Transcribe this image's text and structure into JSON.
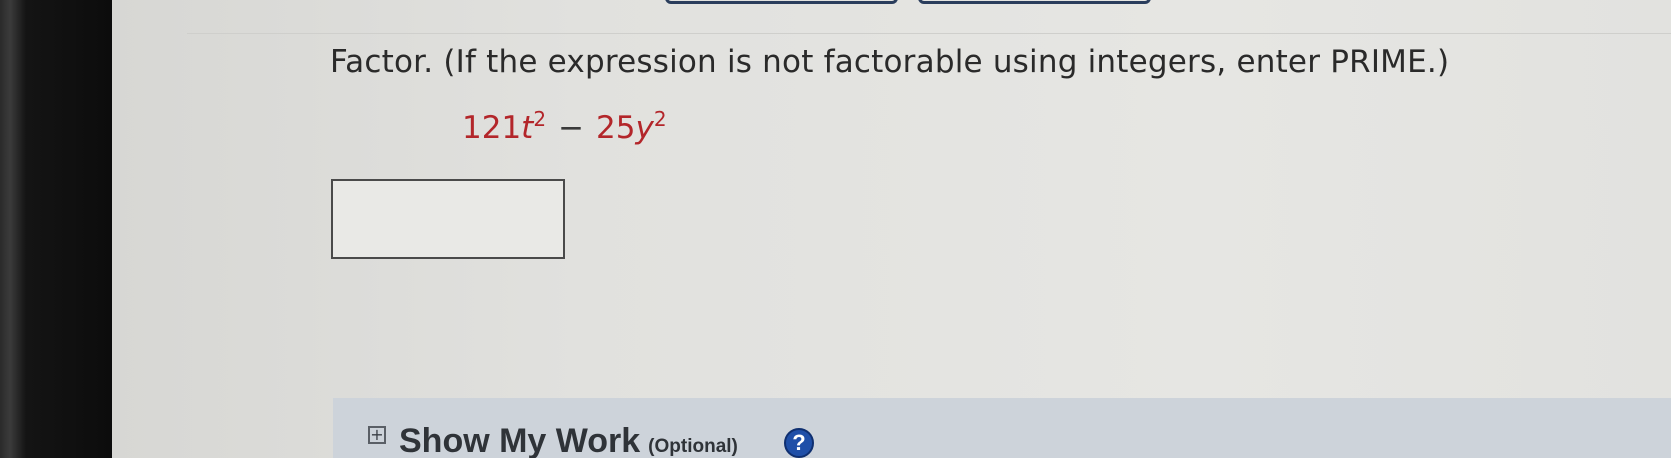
{
  "question": {
    "instruction": "Factor. (If the expression is not factorable using integers, enter PRIME.)"
  },
  "expression": {
    "term1_coef": "121",
    "term1_var": "t",
    "term1_exp": "2",
    "operator": "−",
    "term2_coef": "25",
    "term2_var": "y",
    "term2_exp": "2"
  },
  "answer": {
    "value": "",
    "placeholder": ""
  },
  "show_work": {
    "toggle_symbol": "+",
    "title": "Show My Work",
    "optional_label": "(Optional)",
    "help_symbol": "?"
  },
  "colors": {
    "expression": "#b3262a",
    "help_icon": "#1f4fa8",
    "panel": "#cdd3da"
  }
}
